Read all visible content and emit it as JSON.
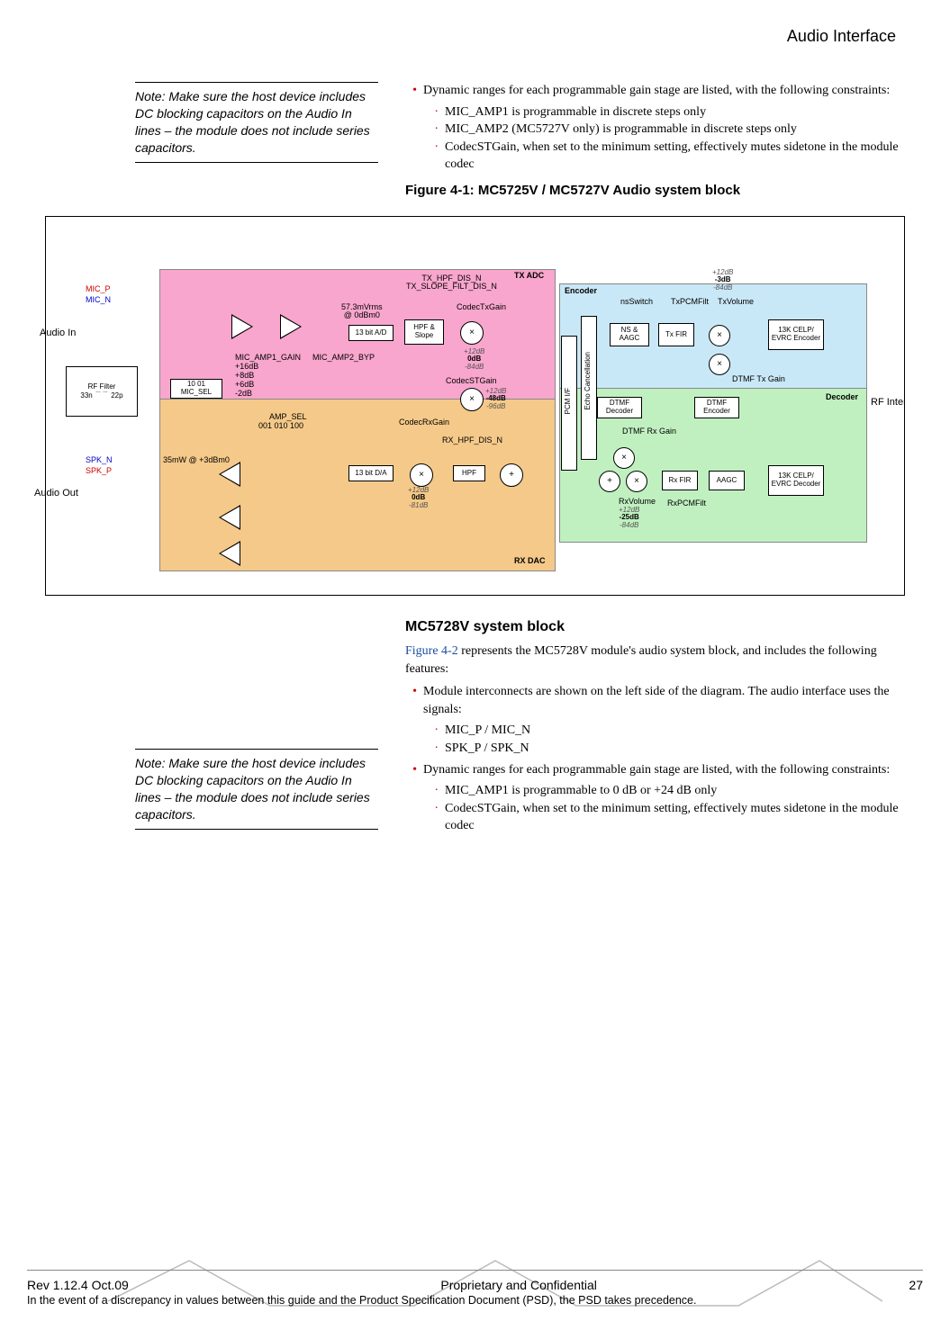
{
  "header": {
    "title": "Audio Interface"
  },
  "note1": "Note:  Make sure the host device includes DC blocking capacitors on the Audio In lines – the module does not include series capacitors.",
  "top_right": {
    "lead": "Dynamic ranges for each programmable gain stage are listed, with the following constraints:",
    "items": [
      "MIC_AMP1 is programmable in discrete steps only",
      "MIC_AMP2 (MC5727V only) is programmable in discrete steps only",
      "CodecSTGain, when set to the minimum setting, effectively mutes sidetone in the module codec"
    ]
  },
  "fig41_caption": "Figure 4-1:  MC5725V / MC5727V Audio system block",
  "diagram": {
    "audio_in": "Audio In",
    "audio_out": "Audio Out",
    "mic_p": "MIC_P",
    "mic_n": "MIC_N",
    "spk_n": "SPK_N",
    "spk_p": "SPK_P",
    "rf_filter": "RF Filter",
    "rf_filter_33n": "33n",
    "rf_filter_22p": "22p",
    "tx_adc": "TX ADC",
    "rx_dac": "RX DAC",
    "encoder": "Encoder",
    "decoder": "Decoder",
    "mic_sel": "MIC_SEL",
    "mic_sel_vals": "10    01",
    "mic_amp1_gain": "MIC_AMP1_GAIN",
    "mic_amp1_vals": "+16dB\n+8dB\n+6dB\n-2dB",
    "mic_amp2_byp": "MIC_AMP2_BYP",
    "adc_rate": "57.3mVrms\n@ 0dBm0",
    "adc13": "13 bit A/D",
    "hpf_slope": "HPF & Slope",
    "tx_hpf": "TX_HPF_DIS_N\nTX_SLOPE_FILT_DIS_N",
    "codec_tx_gain": "CodecTxGain",
    "tx_gain_stack": {
      "hi": "+12dB",
      "mid": "0dB",
      "lo": "-84dB"
    },
    "codec_st_gain": "CodecSTGain",
    "st_gain_stack": {
      "hi": "+12dB",
      "mid": "-48dB",
      "lo": "-96dB"
    },
    "codec_rx_gain": "CodecRxGain",
    "rx_hpf": "RX_HPF_DIS_N",
    "dac13": "13 bit D/A",
    "amp_sel": "AMP_SEL",
    "amp_sel_vals": "001   010   100",
    "dac_power": "35mW @ +3dBm0",
    "hpf": "HPF",
    "rx_gain_stack": {
      "hi": "+12dB",
      "mid": "0dB",
      "lo": "-81dB"
    },
    "pcm_if": "PCM I/F",
    "echo_cancel": "Echo Cancellation",
    "ns_switch": "nsSwitch",
    "ns_aagc": "NS & AAGC",
    "tx_fir": "Tx FIR",
    "tx_pcm_filt": "TxPCMFilt",
    "tx_volume": "TxVolume",
    "tx_vol_stack": {
      "hi": "+12dB",
      "mid": "-3dB",
      "lo": "-84dB"
    },
    "dtmf_tx_gain": "DTMF Tx Gain",
    "dtmf_decoder": "DTMF Decoder",
    "dtmf_encoder": "DTMF Encoder",
    "dtmf_rx_gain": "DTMF Rx Gain",
    "rx_fir": "Rx FIR",
    "aagc": "AAGC",
    "rx_volume": "RxVolume",
    "rx_vol_stack": {
      "hi": "+12dB",
      "mid": "-25dB",
      "lo": "-84dB"
    },
    "rx_pcm_filt": "RxPCMFilt",
    "celp_enc": "13K CELP/ EVRC Encoder",
    "celp_dec": "13K CELP/ EVRC Decoder",
    "rf_interface": "RF Interface"
  },
  "section2": {
    "head": "MC5728V system block",
    "para_lead_link": "Figure 4-2",
    "para_lead_rest": " represents the MC5728V module's audio system block, and includes the following features:",
    "bullet1": "Module interconnects are shown on the left side of the diagram. The audio interface uses the signals:",
    "sub1": "MIC_P / MIC_N",
    "sub2": "SPK_P / SPK_N",
    "dyn_lead": "Dynamic ranges for each programmable gain stage are listed, with the following constraints:",
    "dyn_items": [
      "MIC_AMP1 is programmable to 0 dB or +24 dB only",
      "CodecSTGain, when set to the minimum setting, effectively mutes sidetone in the module codec"
    ]
  },
  "note2": "Note:  Make sure the host device includes DC blocking capacitors on the Audio In lines – the module does not include series capacitors.",
  "footer": {
    "rev": "Rev 1.12.4  Oct.09",
    "center": "Proprietary and Confidential",
    "page": "27",
    "disclaimer": "In the event of a discrepancy in values between this guide and the Product Specification Document (PSD), the PSD takes precedence."
  }
}
